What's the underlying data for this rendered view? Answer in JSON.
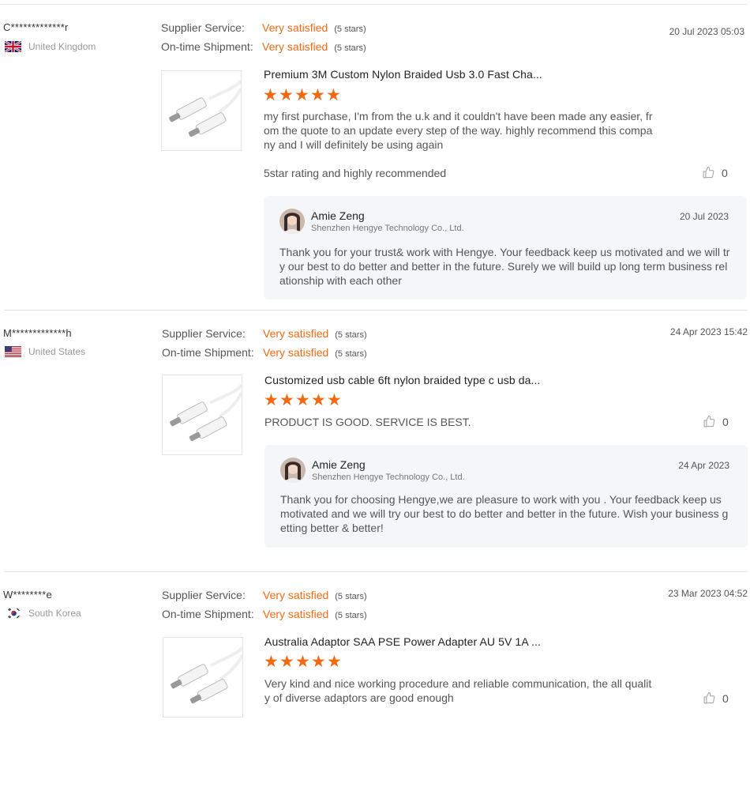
{
  "reviews": [
    {
      "buyer": "C*************r",
      "country": "United Kingdom",
      "flag": "uk",
      "supplier_label": "Supplier Service:",
      "supplier_value": "Very satisfied",
      "supplier_stars": "(5 stars)",
      "shipment_label": "On-time Shipment:",
      "shipment_value": "Very satisfied",
      "shipment_stars": "(5 stars)",
      "date": "20 Jul 2023 05:03",
      "product_title": "Premium 3M Custom Nylon Braided Usb 3.0 Fast Cha...",
      "rating": 5,
      "text": "my first purchase, I'm from the u.k and it couldn't have been made any easier, from the quote to an update every step of the way. highly recommend this company and I will definitely be using again",
      "extra_text": "5star rating and highly recommended",
      "likes": "0",
      "reply": {
        "name": "Amie Zeng",
        "company": "Shenzhen Hengye Technology Co., Ltd.",
        "date": "20 Jul 2023",
        "text": "Thank you for your trust& work with Hengye. Your feedback keep us motivated and we will try our best to do better and better in the future. Surely we will build up long term business relationship with each other"
      }
    },
    {
      "buyer": "M*************h",
      "country": "United States",
      "flag": "us",
      "supplier_label": "Supplier Service:",
      "supplier_value": "Very satisfied",
      "supplier_stars": "(5 stars)",
      "shipment_label": "On-time Shipment:",
      "shipment_value": "Very satisfied",
      "shipment_stars": "(5 stars)",
      "date": "24 Apr 2023 15:42",
      "product_title": "Customized usb cable 6ft nylon braided type c usb da...",
      "rating": 5,
      "text": "PRODUCT IS GOOD. SERVICE IS BEST.",
      "likes": "0",
      "reply": {
        "name": "Amie Zeng",
        "company": "Shenzhen Hengye Technology Co., Ltd.",
        "date": "24 Apr 2023",
        "text": "Thank you for choosing Hengye,we are pleasure to work with you . Your feedback keep us motivated and we will try our best to do better and better in the future. Wish your business getting better & better!"
      }
    },
    {
      "buyer": "W********e",
      "country": "South Korea",
      "flag": "kr",
      "supplier_label": "Supplier Service:",
      "supplier_value": "Very satisfied",
      "supplier_stars": "(5 stars)",
      "shipment_label": "On-time Shipment:",
      "shipment_value": "Very satisfied",
      "shipment_stars": "(5 stars)",
      "date": "23 Mar 2023 04:52",
      "product_title": "Australia Adaptor SAA PSE Power Adapter AU 5V 1A ...",
      "rating": 5,
      "text": "Very kind and nice working procedure and reliable communication, the all quality of diverse adaptors are good enough",
      "likes": "0"
    }
  ],
  "colors": {
    "accent": "#f06a14",
    "reply_bg": "#f5f6f7"
  },
  "icons": {
    "like": "thumbs-up-icon",
    "star": "star-icon"
  }
}
